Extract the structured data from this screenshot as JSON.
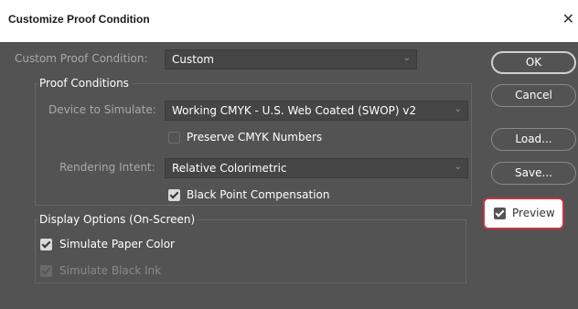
{
  "window": {
    "title": "Customize Proof Condition",
    "close_icon": "close-icon"
  },
  "custom": {
    "label": "Custom Proof Condition:",
    "value": "Custom"
  },
  "proof": {
    "legend": "Proof Conditions",
    "device_label": "Device to Simulate:",
    "device_value": "Working CMYK - U.S. Web Coated (SWOP) v2",
    "preserve_label": "Preserve CMYK Numbers",
    "preserve_checked": false,
    "intent_label": "Rendering Intent:",
    "intent_value": "Relative Colorimetric",
    "bpc_label": "Black Point Compensation",
    "bpc_checked": true
  },
  "display": {
    "legend": "Display Options (On-Screen)",
    "paper_label": "Simulate Paper Color",
    "paper_checked": true,
    "ink_label": "Simulate Black Ink",
    "ink_checked": true,
    "ink_enabled": false
  },
  "buttons": {
    "ok": "OK",
    "cancel": "Cancel",
    "load": "Load...",
    "save": "Save...",
    "preview_label": "Preview",
    "preview_checked": true
  },
  "colors": {
    "dialog_bg": "#535353",
    "highlight": "#c8323f"
  }
}
